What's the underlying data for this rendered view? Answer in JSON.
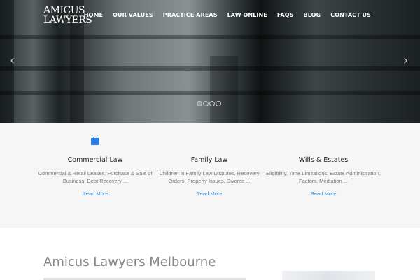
{
  "header": {
    "logo_line1": "AMICUS",
    "logo_line2": "LAWYERS",
    "nav": [
      "HOME",
      "OUR VALUES",
      "PRACTICE AREAS",
      "LAW ONLINE",
      "FAQS",
      "BLOG",
      "CONTACT US"
    ]
  },
  "slider": {
    "prev": "‹",
    "next": "›",
    "slide_count": 4,
    "active_slide": 1
  },
  "services": [
    {
      "title": "Commercial Law",
      "icon": "briefcase-icon",
      "desc": "Commercial & Retail Leases, Purchase & Sale of Business, Debt Recovery ...",
      "link": "Read More"
    },
    {
      "title": "Family Law",
      "desc": "Children in Family Law Disputes, Recovery Orders, Property Issues, Divorce ...",
      "link": "Read More"
    },
    {
      "title": "Wills & Estates",
      "desc": "Eligibility, Time Limitations, Estate Administration, Factors, Mediation ...",
      "link": "Read More"
    }
  ],
  "about": {
    "title": "Amicus Lawyers Melbourne"
  },
  "colors": {
    "accent": "#3a86d4",
    "icon": "#2a7ae2"
  }
}
